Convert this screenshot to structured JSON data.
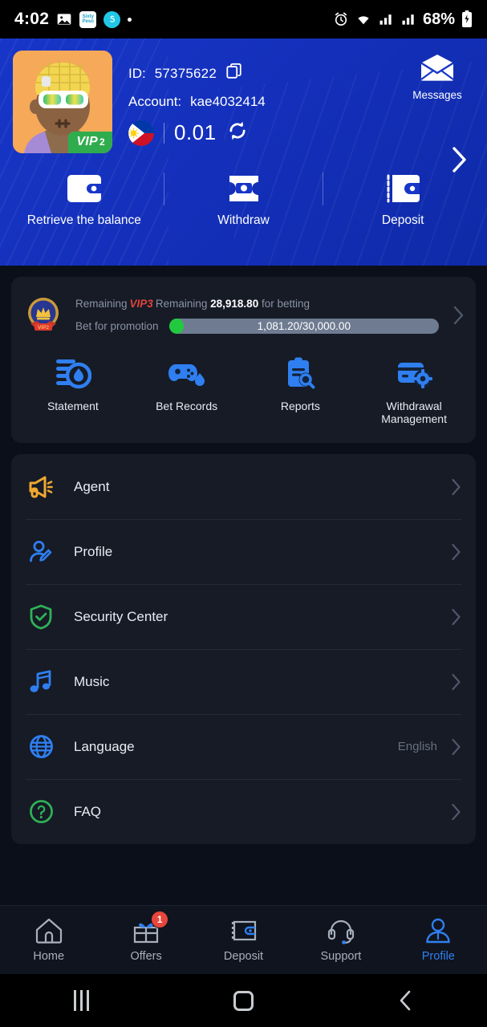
{
  "status_bar": {
    "time": "4:02",
    "icons": [
      "image-icon",
      "sixty-peso-app-icon",
      "shopee-app-icon",
      "dot-indicator"
    ],
    "app_icon_text": "Sixty Peso",
    "right_icons": [
      "alarm-icon",
      "wifi-icon",
      "signal-icon",
      "signal-icon-2"
    ],
    "battery": "68%"
  },
  "header": {
    "id_label": "ID:",
    "id_value": "57375622",
    "account_label": "Account:",
    "account_value": "kae4032414",
    "balance": "0.01",
    "currency_flag": "philippines-flag",
    "refresh_icon": "refresh-icon",
    "copy_icon": "copy-icon",
    "vip_badge": "VIP",
    "vip_level": "2",
    "messages_label": "Messages",
    "messages_icon": "envelope-icon",
    "chevron_icon": "chevron-right-icon",
    "actions": [
      {
        "label": "Retrieve the balance",
        "icon": "wallet-icon"
      },
      {
        "label": "Withdraw",
        "icon": "withdraw-ticket-icon"
      },
      {
        "label": "Deposit",
        "icon": "deposit-wallet-icon"
      }
    ],
    "accent_color": "#1736c8"
  },
  "vip_card": {
    "medal_icon": "vip-medal-icon",
    "remaining_prefix": "Remaining",
    "next_level": "VIP3",
    "remaining_word": "Remaining",
    "remaining_amount": "28,918.80",
    "remaining_suffix": "for betting",
    "progress_caption": "Bet for promotion",
    "progress_text": "1,081.20/30,000.00",
    "progress_current": 1081.2,
    "progress_total": 30000.0,
    "progress_fill_color": "#22c93f",
    "chevron_icon": "chevron-right-icon"
  },
  "quick_actions": [
    {
      "label": "Statement",
      "icon": "statement-icon"
    },
    {
      "label": "Bet Records",
      "icon": "game-controller-icon"
    },
    {
      "label": "Reports",
      "icon": "reports-clipboard-icon"
    },
    {
      "label": "Withdrawal Management",
      "icon": "withdrawal-management-icon"
    }
  ],
  "menu": [
    {
      "label": "Agent",
      "icon": "megaphone-icon",
      "value": ""
    },
    {
      "label": "Profile",
      "icon": "profile-edit-icon",
      "value": ""
    },
    {
      "label": "Security Center",
      "icon": "shield-check-icon",
      "value": ""
    },
    {
      "label": "Music",
      "icon": "music-note-icon",
      "value": ""
    },
    {
      "label": "Language",
      "icon": "globe-icon",
      "value": "English"
    },
    {
      "label": "FAQ",
      "icon": "question-circle-icon",
      "value": ""
    }
  ],
  "bottom_nav": [
    {
      "label": "Home",
      "icon": "home-icon",
      "active": false,
      "badge": ""
    },
    {
      "label": "Offers",
      "icon": "gift-icon",
      "active": false,
      "badge": "1"
    },
    {
      "label": "Deposit",
      "icon": "deposit-wallet-icon",
      "active": false,
      "badge": ""
    },
    {
      "label": "Support",
      "icon": "headset-icon",
      "active": false,
      "badge": ""
    },
    {
      "label": "Profile",
      "icon": "person-icon",
      "active": true,
      "badge": ""
    }
  ],
  "android_nav": {
    "recents": "recents-icon",
    "home": "home-square-icon",
    "back": "back-chevron-icon"
  }
}
